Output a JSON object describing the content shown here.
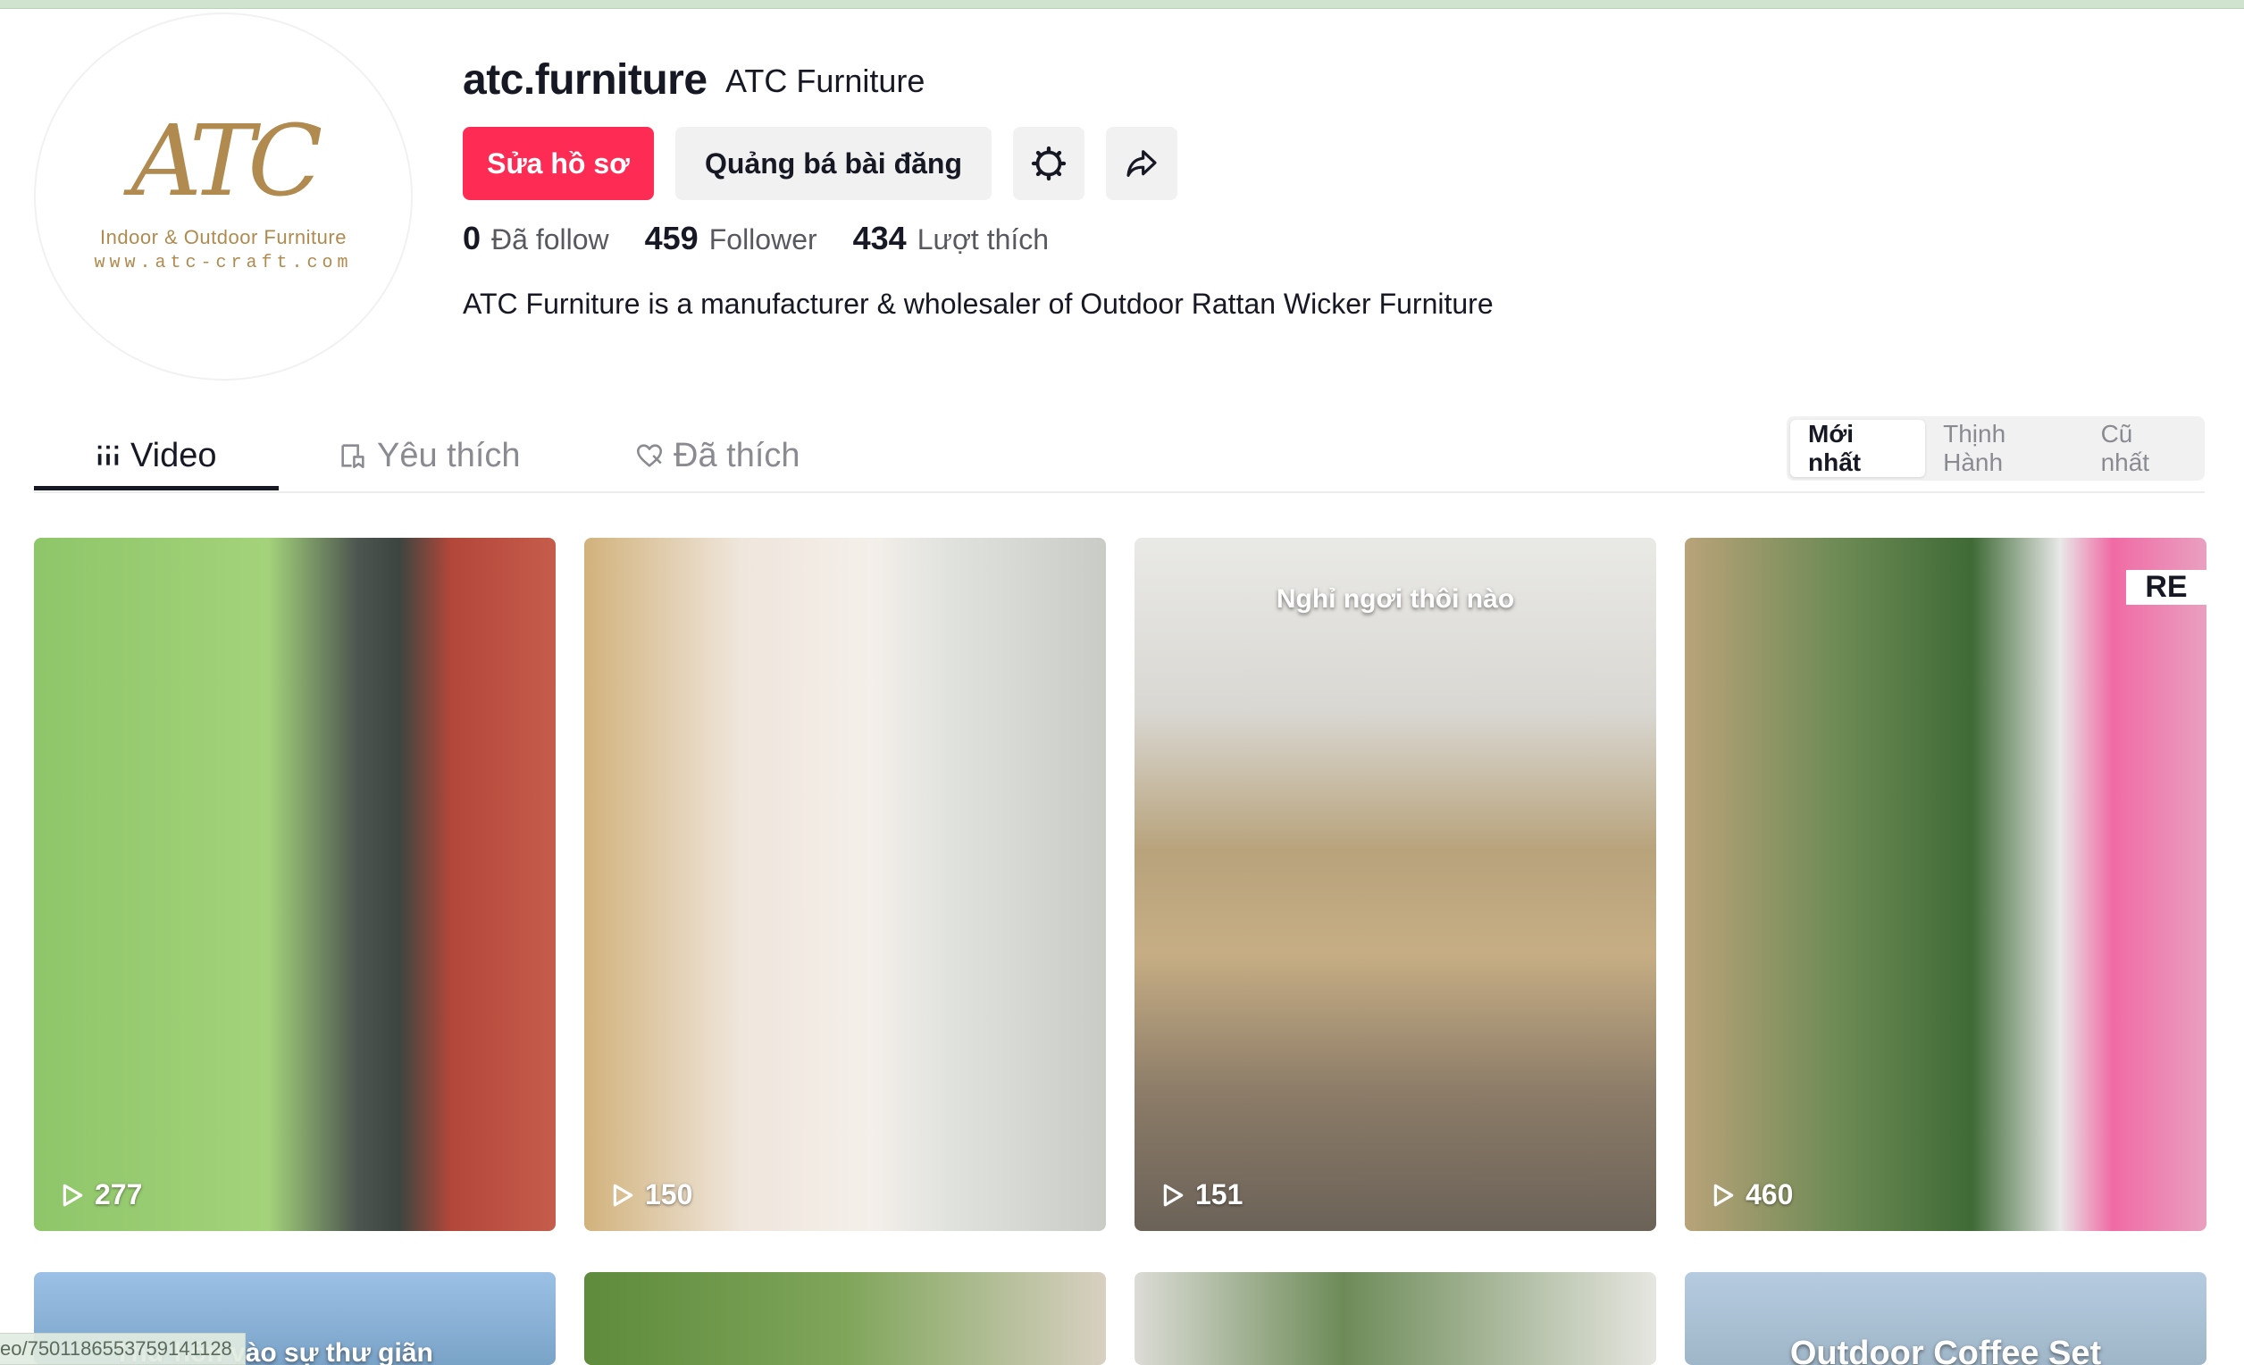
{
  "profile": {
    "username": "atc.furniture",
    "nickname": "ATC Furniture",
    "avatar_logo": {
      "mark": "ATC",
      "line1": "Indoor & Outdoor Furniture",
      "line2": "www.atc-craft.com"
    },
    "buttons": {
      "edit": "Sửa hồ sơ",
      "promote": "Quảng bá bài đăng",
      "settings_icon": "gear-icon",
      "share_icon": "share-icon"
    },
    "stats": [
      {
        "value": "0",
        "label": "Đã follow"
      },
      {
        "value": "459",
        "label": "Follower"
      },
      {
        "value": "434",
        "label": "Lượt thích"
      }
    ],
    "bio": "ATC Furniture is a manufacturer & wholesaler of Outdoor Rattan Wicker Furniture"
  },
  "tabs": [
    {
      "label": "Video",
      "icon": "grid-icon",
      "active": true
    },
    {
      "label": "Yêu thích",
      "icon": "bookmark-icon",
      "active": false
    },
    {
      "label": "Đã thích",
      "icon": "heart-icon",
      "active": false
    }
  ],
  "sort": {
    "options": [
      "Mới nhất",
      "Thịnh Hành",
      "Cũ nhất"
    ],
    "selected": "Mới nhất"
  },
  "videos": [
    {
      "views": "277",
      "overlay": ""
    },
    {
      "views": "150",
      "overlay": ""
    },
    {
      "views": "151",
      "overlay": "Nghỉ ngơi thôi nào"
    },
    {
      "views": "460",
      "overlay": "RE"
    },
    {
      "views": "",
      "overlay": "Thư hồn vào sự thư giãn"
    },
    {
      "views": "",
      "overlay": ""
    },
    {
      "views": "",
      "overlay": ""
    },
    {
      "views": "",
      "overlay": "Outdoor Coffee Set"
    }
  ],
  "status_url": "eo/7501186553759141128",
  "colors": {
    "primary": "#fe2c55",
    "text": "#161823",
    "secondary_text": "#57595f",
    "button_bg": "#f1f1f2",
    "logo_gold": "#b08a4e"
  }
}
